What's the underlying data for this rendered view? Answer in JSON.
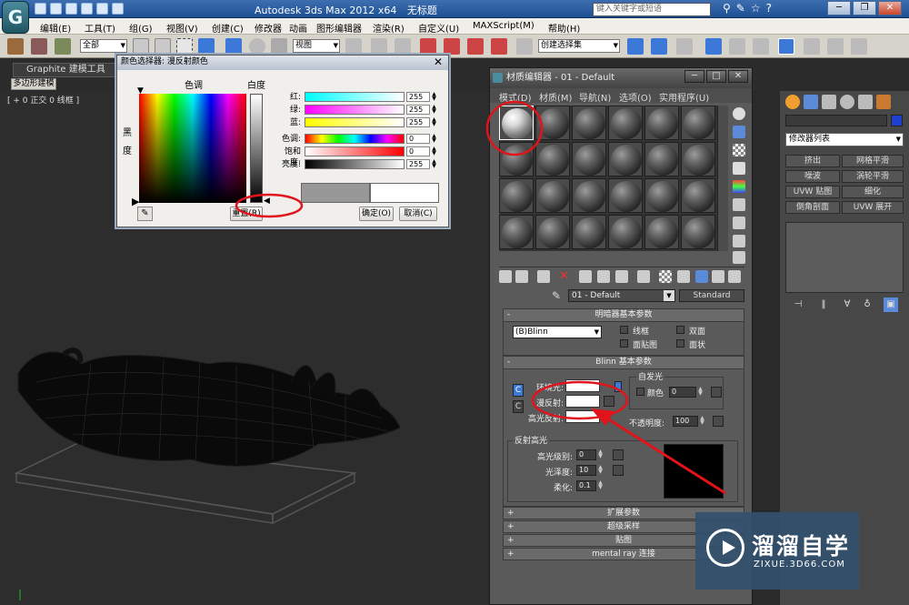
{
  "titlebar": {
    "logo": "G",
    "app_title": "Autodesk 3ds Max  2012 x64",
    "doc_title": "无标题",
    "search_placeholder": "键入关键字或短语"
  },
  "menubar": {
    "items": [
      "编辑(E)",
      "工具(T)",
      "组(G)",
      "视图(V)",
      "创建(C)",
      "修改器",
      "动画",
      "图形编辑器",
      "渲染(R)",
      "自定义(U)",
      "MAXScript(M)",
      "帮助(H)"
    ]
  },
  "toolbar": {
    "filter_select": "全部",
    "view_select": "视图",
    "selection_set": "创建选择集"
  },
  "ribbon": {
    "graphite_tab": "Graphite 建模工具",
    "poly_tab": "多边形建模"
  },
  "viewport": {
    "label": "[ + 0 正交 0 线框 ]"
  },
  "color_picker": {
    "title": "颜色选择器: 漫反射颜色",
    "hue_label": "色调",
    "whiteness_label": "白度",
    "blackness_label": "黑度",
    "rows": [
      {
        "label": "红:",
        "value": "255",
        "bar_color": "linear-gradient(to right, #00ffff, #ffffff)"
      },
      {
        "label": "绿:",
        "value": "255",
        "bar_color": "linear-gradient(to right, #ff00ff, #ffffff)"
      },
      {
        "label": "蓝:",
        "value": "255",
        "bar_color": "linear-gradient(to right, #ffff00, #ffffff)"
      },
      {
        "label": "色调:",
        "value": "0",
        "bar_color": "linear-gradient(to right, #f00, #ff0, #0f0, #0ff, #00f, #f0f, #f00)"
      },
      {
        "label": "饱和度:",
        "value": "0",
        "bar_color": "linear-gradient(to right, #ffffff, #ff0000)"
      },
      {
        "label": "亮度:",
        "value": "255",
        "bar_color": "linear-gradient(to right, #000000, #ffffff)"
      }
    ],
    "reset_button": "重置(R)",
    "ok_button": "确定(O)",
    "cancel_button": "取消(C)"
  },
  "material_editor": {
    "title": "材质编辑器 - 01 - Default",
    "menu": [
      "模式(D)",
      "材质(M)",
      "导航(N)",
      "选项(O)",
      "实用程序(U)"
    ],
    "material_name": "01 - Default",
    "material_type": "Standard",
    "shader_rollout": {
      "title": "明暗器基本参数",
      "shader": "(B)Blinn",
      "wire": "线框",
      "two_sided": "双面",
      "face_map": "面贴图",
      "faceted": "面状"
    },
    "blinn_rollout": {
      "title": "Blinn 基本参数",
      "ambient": "环境光:",
      "diffuse": "漫反射:",
      "specular": "高光反射:",
      "self_illum": "自发光",
      "color_chk": "颜色",
      "self_illum_value": "0",
      "opacity_label": "不透明度:",
      "opacity_value": "100",
      "spec_highlights": "反射高光",
      "spec_level_label": "高光级别:",
      "spec_level_value": "0",
      "gloss_label": "光泽度:",
      "gloss_value": "10",
      "soften_label": "柔化:",
      "soften_value": "0.1"
    },
    "collapsed_rollouts": [
      "扩展参数",
      "超级采样",
      "贴图",
      "mental ray 连接"
    ]
  },
  "command_panel": {
    "modifier_list": "修改器列表",
    "buttons": [
      "挤出",
      "网格平滑",
      "噪波",
      "涡轮平滑",
      "UVW 贴图",
      "细化",
      "倒角剖面",
      "UVW 展开"
    ]
  },
  "watermark": {
    "title": "溜溜自学",
    "url": "ZIXUE.3D66.COM"
  },
  "colors": {
    "annotation_red": "#e0141a",
    "accent_blue": "#2b66c8"
  }
}
